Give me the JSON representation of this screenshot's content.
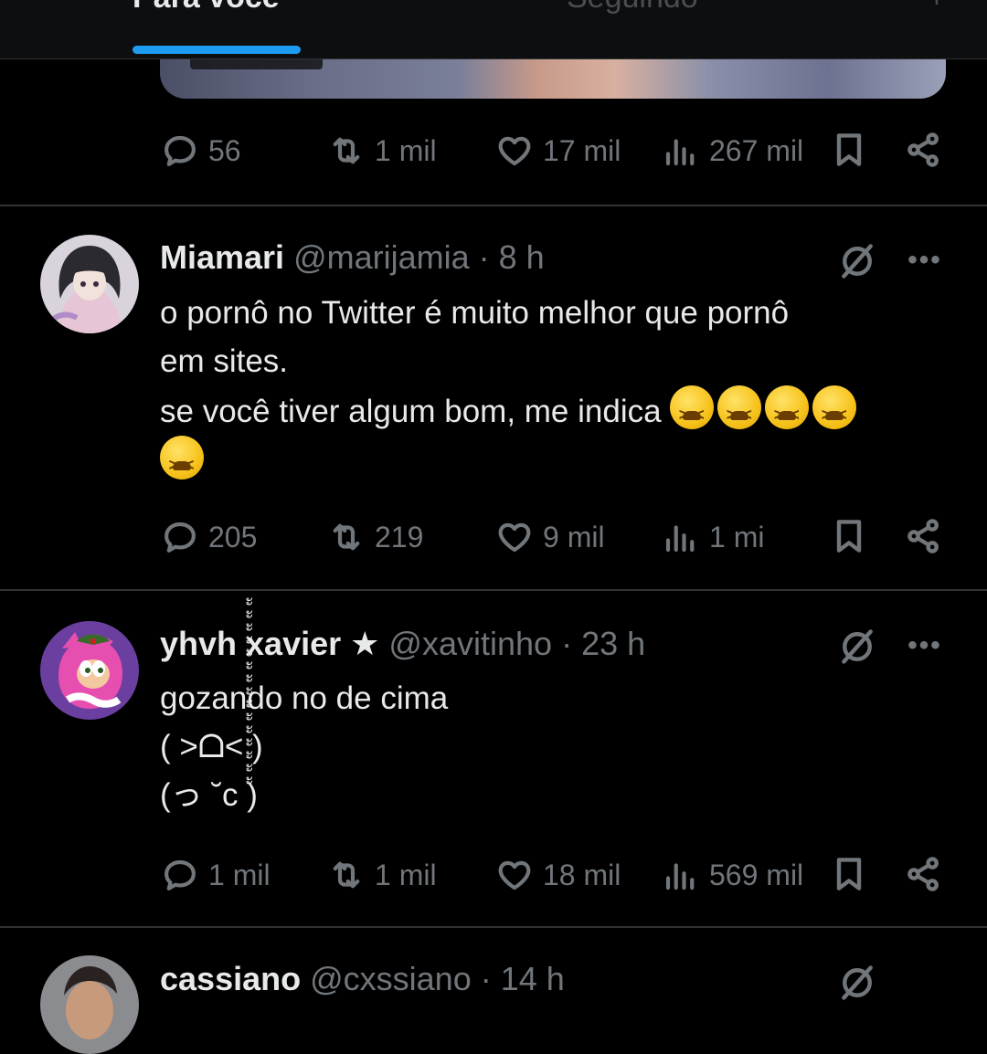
{
  "tabs": {
    "for_you": "Para você",
    "following": "Seguindo",
    "add": "+"
  },
  "accent": "#1d9bf0",
  "top_post": {
    "actions": {
      "replies": "56",
      "reposts": "1 mil",
      "likes": "17 mil",
      "views": "267 mil"
    }
  },
  "posts": [
    {
      "name": "Miamari",
      "handle": "@marijamia",
      "time": "· 8 h",
      "text_lines": [
        "o pornô no Twitter é muito melhor que pornô",
        "em sites.",
        "se você tiver algum bom, me indica"
      ],
      "actions": {
        "replies": "205",
        "reposts": "219",
        "likes": "9 mil",
        "views": "1 mi"
      }
    },
    {
      "name": "yhvh xavier ★",
      "handle": "@xavitinho",
      "time": "· 23 h",
      "text_lines": [
        "gozando no de cima",
        "( >ᗝ< )",
        "(っ ˘c )"
      ],
      "actions": {
        "replies": "1 mil",
        "reposts": "1 mil",
        "likes": "18 mil",
        "views": "569 mil"
      }
    },
    {
      "name": "cassiano",
      "handle": "@cxssiano",
      "time": "· 14 h"
    }
  ],
  "icons": {
    "reply": "reply-icon",
    "repost": "repost-icon",
    "like": "heart-icon",
    "views": "views-icon",
    "bookmark": "bookmark-icon",
    "share": "share-icon",
    "grok": "grok-icon",
    "more": "more-icon"
  }
}
